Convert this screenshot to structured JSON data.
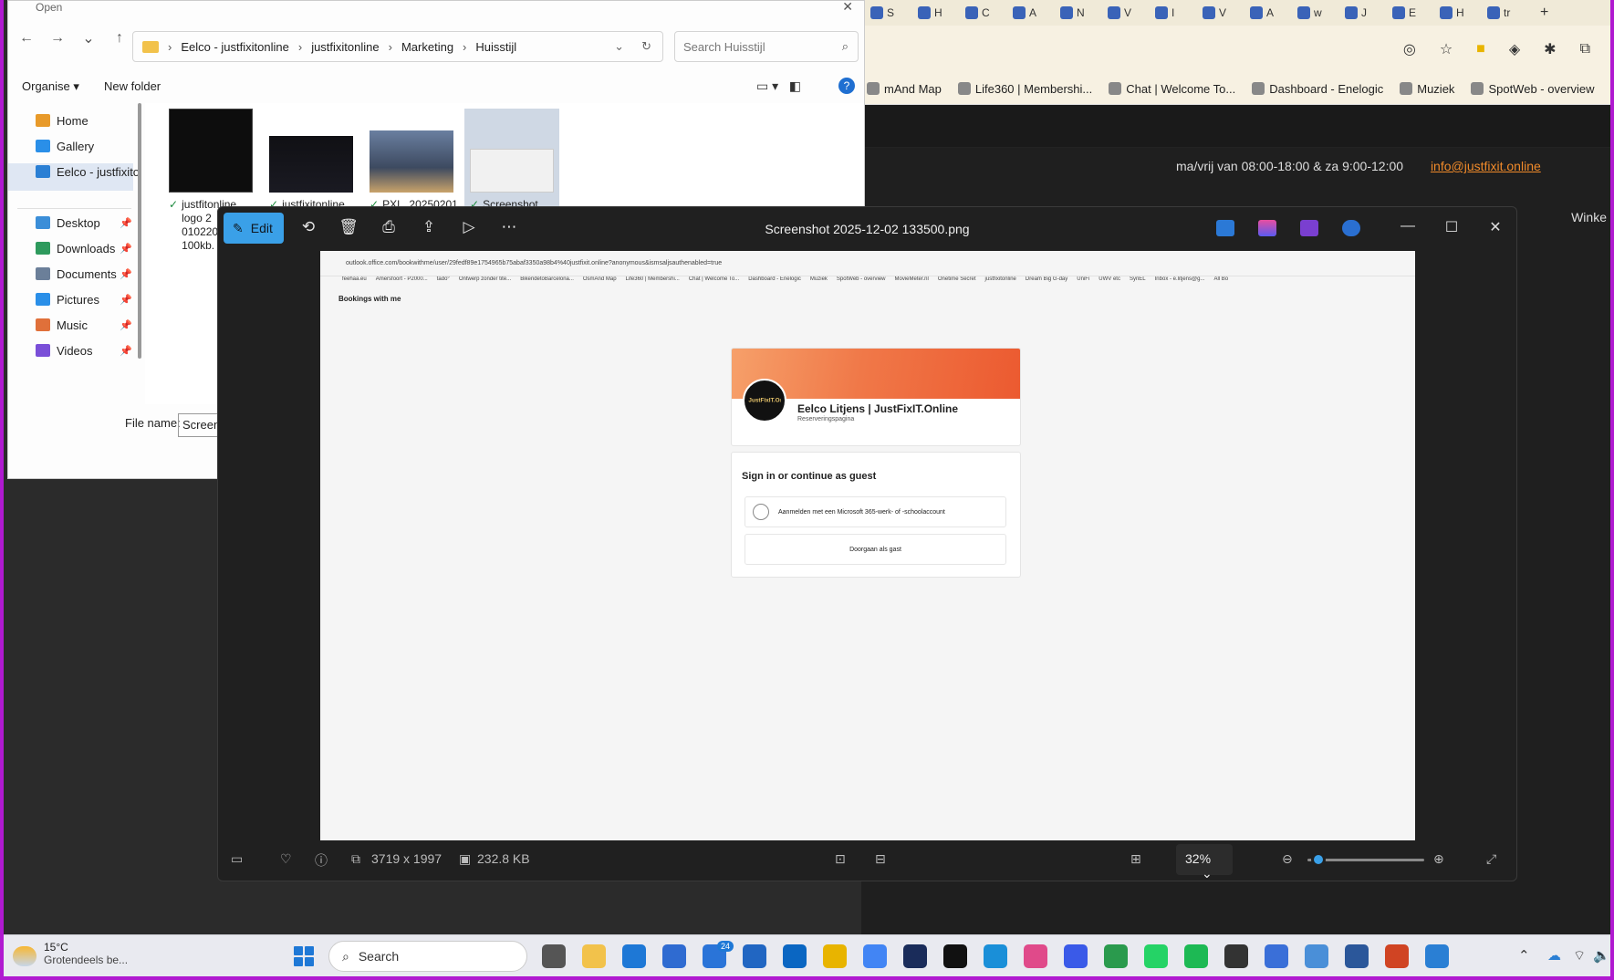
{
  "dialog": {
    "title": "Open",
    "breadcrumb": [
      "Eelco - justfixitonline",
      "justfixitonline",
      "Marketing",
      "Huisstijl"
    ],
    "search_placeholder": "Search Huisstijl",
    "organise": "Organise",
    "new_folder": "New folder",
    "sidebar": [
      {
        "label": "Home",
        "icon": "home-icon",
        "color": "#e89a2a"
      },
      {
        "label": "Gallery",
        "icon": "gallery-icon",
        "color": "#2a8fe8"
      },
      {
        "label": "Eelco - justfixito",
        "icon": "onedrive-icon",
        "color": "#2a7fd4"
      },
      {
        "label": "Desktop",
        "icon": "desktop-icon",
        "color": "#3b8ed8"
      },
      {
        "label": "Downloads",
        "icon": "download-icon",
        "color": "#2e9a5d"
      },
      {
        "label": "Documents",
        "icon": "documents-icon",
        "color": "#6b7f99"
      },
      {
        "label": "Pictures",
        "icon": "pictures-icon",
        "color": "#2a8fe8"
      },
      {
        "label": "Music",
        "icon": "music-icon",
        "color": "#e0703a"
      },
      {
        "label": "Videos",
        "icon": "videos-icon",
        "color": "#7a4fd8"
      }
    ],
    "files": [
      {
        "lines": [
          "justfitonline",
          "logo 2",
          "010220",
          "100kb."
        ],
        "thumb": "logo"
      },
      {
        "lines": [
          "justfixitonline"
        ],
        "thumb": "dark"
      },
      {
        "lines": [
          "PXL_20250201_"
        ],
        "thumb": "photo"
      },
      {
        "lines": [
          "Screenshot"
        ],
        "thumb": "screenshot"
      }
    ],
    "filename_label": "File name:",
    "filename_value": "Screens"
  },
  "browser": {
    "tabs": [
      "S",
      "H",
      "C",
      "A",
      "N",
      "V",
      "I",
      "V",
      "A",
      "w",
      "J",
      "E",
      "H",
      "tr"
    ],
    "bookmarks": [
      "mAnd Map",
      "Life360 | Membershi...",
      "Chat | Welcome To...",
      "Dashboard - Enelogic",
      "Muziek",
      "SpotWeb - overview"
    ],
    "contact": "ma/vrij van 08:00-18:00 & za 9:00-12:00",
    "email": "info@justfixit.online",
    "side_text": "Winke"
  },
  "viewer": {
    "edit_label": "Edit",
    "title": "Screenshot 2025-12-02 133500.png",
    "dimensions": "3719 x 1997",
    "size": "232.8 KB",
    "zoom": "32%",
    "zoom_fraction": 0.06
  },
  "inner": {
    "url": "outlook.office.com/bookwithme/user/29fedf89e1754965b75abaf3350a98b4%40justfixit.online?anonymous&ismsaljsauthenabled=true",
    "bookmarks": [
      "feehaa.eu",
      "Amersfoort - P2000...",
      "tado°",
      "Ontwerp zonder tite...",
      "BikeridetoBarcelona...",
      "OsmAnd Map",
      "Life360 | Membershi...",
      "Chat | Welcome To...",
      "Dashboard - Enelogic",
      "Muziek",
      "SpotWeb - overview",
      "MovieMeter.nl",
      "Onetime Secret",
      "justfixitonline",
      "Dream Big G-day",
      "UniFi",
      "UWV etc",
      "SynEL",
      "Inbox - e.litjens@g...",
      "All Bo"
    ],
    "page_title": "Bookings with me",
    "card_name": "Eelco Litjens | JustFixIT.Online",
    "card_sub": "Reserveringspagina",
    "avatar_text": "JustFixIT.Online",
    "sign_in_heading": "Sign in or continue as guest",
    "ms_button": "Aanmelden met een Microsoft 365-werk- of -schoolaccount",
    "guest_button": "Doorgaan als gast"
  },
  "taskbar": {
    "temp": "15°C",
    "weather": "Grotendeels be...",
    "search": "Search",
    "badge": "24"
  }
}
